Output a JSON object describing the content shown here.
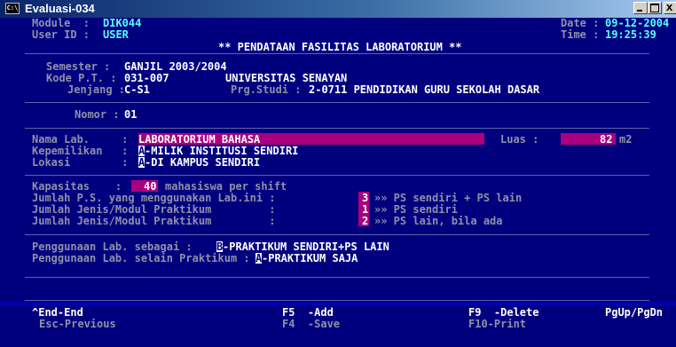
{
  "window": {
    "title": "Evaluasi-034",
    "icon": "console-icon",
    "icon_text": "C:\\"
  },
  "header": {
    "module_label": "Module  :",
    "module_value": "DIK044",
    "user_label": "User ID :",
    "user_value": "USER",
    "date_label": "Date :",
    "date_value": "09-12-2004",
    "time_label": "Time :",
    "time_value": "19:25:39",
    "screen_title": "** PENDATAAN FASILITAS LABORATORIUM **"
  },
  "info": {
    "semester_label": "Semester :",
    "semester_value": "GANJIL 2003/2004",
    "kode_label": "Kode P.T. :",
    "kode_value": "031-007",
    "pt_name": "UNIVERSITAS SENAYAN",
    "jenjang_label": "Jenjang :",
    "jenjang_value": "C-S1",
    "prodi_label": "Prg.Studi :",
    "prodi_value": "2-0711 PENDIDIKAN GURU SEKOLAH DASAR"
  },
  "nomor": {
    "label": "Nomor :",
    "value": "01"
  },
  "lab": {
    "nama_label": "Nama Lab.     :",
    "nama_value": "LABORATORIUM BAHASA",
    "luas_label": "Luas :",
    "luas_value": "82",
    "luas_unit": "m2",
    "kepemilikan_label": "Kepemilikan   :",
    "kepemilikan_code": "A",
    "kepemilikan_text": "-MILIK INSTITUSI SENDIRI",
    "lokasi_label": "Lokasi        :",
    "lokasi_code": "A",
    "lokasi_text": "-DI KAMPUS SENDIRI"
  },
  "capacity": {
    "kapasitas_label": "Kapasitas    :",
    "kapasitas_value": "40",
    "kapasitas_unit": "mahasiswa per shift",
    "row1_label": "Jumlah P.S. yang menggunakan Lab.ini :",
    "row1_value": "3",
    "row1_note": "»» PS sendiri + PS lain",
    "row2_label": "Jumlah Jenis/Modul Praktikum         :",
    "row2_value": "1",
    "row2_note": "»» PS sendiri",
    "row3_label": "Jumlah Jenis/Modul Praktikum         :",
    "row3_value": "2",
    "row3_note": "»» PS lain, bila ada"
  },
  "usage": {
    "row1_label": "Penggunaan Lab. sebagai :",
    "row1_code": "B",
    "row1_text": "-PRAKTIKUM SENDIRI+PS LAIN",
    "row2_label": "Penggunaan Lab. selain Praktikum :",
    "row2_code": "A",
    "row2_text": "-PRAKTIKUM SAJA"
  },
  "footer": {
    "end_key": "^End-End",
    "esc_key": "Esc-Previous",
    "f5_key": "F5  -Add",
    "f4_key": "F4  -Save",
    "f9_key": "F9  -Delete",
    "f10_key": "F10-Print",
    "pg_key": "PgUp/PgDn"
  },
  "colors": {
    "background": "#00007f",
    "highlight": "#aa0080",
    "label": "#9090a8",
    "header_value": "#55ffff",
    "value": "#ffffff"
  }
}
